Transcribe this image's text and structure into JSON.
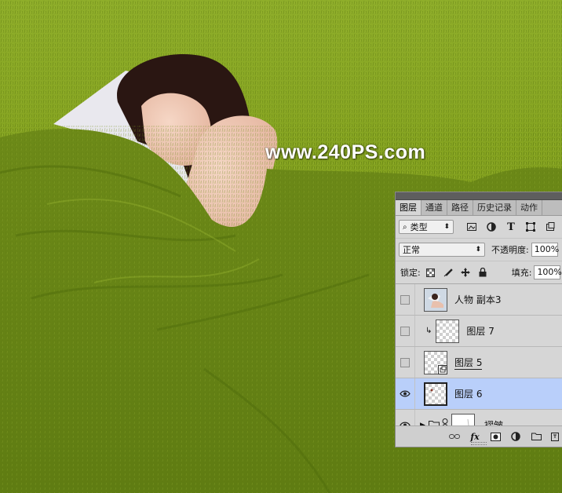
{
  "watermark": "www.240PS.com",
  "colors": {
    "grass": "#7d9a1a",
    "panel": "#d6d6d6",
    "selected_layer": "#b9cffa"
  },
  "panel": {
    "tabs": [
      "图层",
      "通道",
      "路径",
      "历史记录",
      "动作"
    ],
    "active_tab": "图层",
    "filter": {
      "icon": "search-icon",
      "label": "类型"
    },
    "filter_icons": [
      "image-filter-icon",
      "adjustment-filter-icon",
      "text-filter-icon",
      "shape-filter-icon",
      "smart-object-filter-icon"
    ],
    "blend_mode": "正常",
    "opacity_label": "不透明度:",
    "opacity_value": "100%",
    "lock_label": "锁定:",
    "lock_icons": [
      "lock-transparent-icon",
      "lock-image-icon",
      "lock-position-icon",
      "lock-all-icon"
    ],
    "fill_label": "填充:",
    "fill_value": "100%",
    "layers": [
      {
        "name": "人物 副本3",
        "visible": false,
        "thumb": "photo",
        "clipped": false,
        "selected": false
      },
      {
        "name": "图层 7",
        "visible": false,
        "thumb": "transparent",
        "clipped": true,
        "selected": false
      },
      {
        "name": "图层 5",
        "visible": false,
        "thumb": "transparent-smart",
        "clipped": false,
        "selected": false
      },
      {
        "name": "图层 6",
        "visible": true,
        "thumb": "transparent-dot",
        "clipped": false,
        "selected": true
      },
      {
        "name": "褶皱",
        "visible": true,
        "thumb": "group-mask",
        "clipped": false,
        "selected": false
      }
    ],
    "bottom_icons": [
      "link-icon",
      "fx-icon",
      "mask-icon",
      "adjustment-icon",
      "folder-icon",
      "new-layer-icon"
    ]
  }
}
